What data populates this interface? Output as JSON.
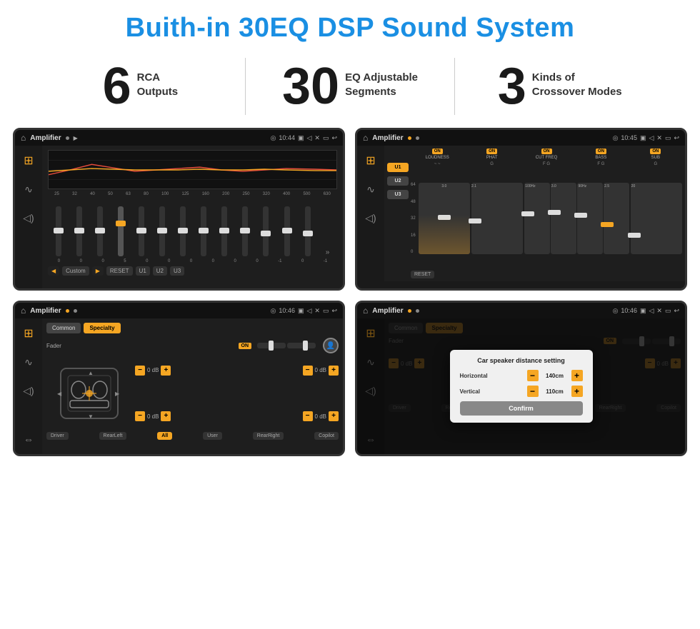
{
  "title": "Buith-in 30EQ DSP Sound System",
  "stats": [
    {
      "number": "6",
      "label": "RCA\nOutputs"
    },
    {
      "number": "30",
      "label": "EQ Adjustable\nSegments"
    },
    {
      "number": "3",
      "label": "Kinds of\nCrossover Modes"
    }
  ],
  "screens": [
    {
      "id": "eq-screen",
      "statusTime": "10:44",
      "title": "Amplifier",
      "freqLabels": [
        "25",
        "32",
        "40",
        "50",
        "63",
        "80",
        "100",
        "125",
        "160",
        "200",
        "250",
        "320",
        "400",
        "500",
        "630"
      ],
      "sliderValues": [
        "0",
        "0",
        "0",
        "5",
        "0",
        "0",
        "0",
        "0",
        "0",
        "0",
        "-1",
        "0",
        "-1"
      ],
      "bottomBtns": [
        "Custom",
        "RESET",
        "U1",
        "U2",
        "U3"
      ]
    },
    {
      "id": "crossover-screen",
      "statusTime": "10:45",
      "title": "Amplifier",
      "presets": [
        "U1",
        "U2",
        "U3"
      ],
      "channels": [
        "LOUDNESS",
        "PHAT",
        "CUT FREQ",
        "BASS",
        "SUB"
      ],
      "resetBtn": "RESET"
    },
    {
      "id": "fader-screen",
      "statusTime": "10:46",
      "title": "Amplifier",
      "tabs": [
        "Common",
        "Specialty"
      ],
      "faderLabel": "Fader",
      "dbValues": [
        "0 dB",
        "0 dB",
        "0 dB",
        "0 dB"
      ],
      "bottomLabels": [
        "Driver",
        "RearLeft",
        "All",
        "User",
        "RearRight",
        "Copilot"
      ]
    },
    {
      "id": "dialog-screen",
      "statusTime": "10:46",
      "title": "Amplifier",
      "tabs": [
        "Common",
        "Specialty"
      ],
      "dialogTitle": "Car speaker distance setting",
      "dialogFields": [
        {
          "label": "Horizontal",
          "value": "140cm"
        },
        {
          "label": "Vertical",
          "value": "110cm"
        }
      ],
      "confirmLabel": "Confirm",
      "dbValues": [
        "0 dB",
        "0 dB"
      ],
      "bottomLabels": [
        "Driver",
        "RearLeft",
        "All",
        "User",
        "RearRight",
        "Copilot"
      ]
    }
  ],
  "icons": {
    "home": "⌂",
    "settings": "≡",
    "wave": "∿",
    "speaker": "◁",
    "tune": "⊞",
    "back": "↩",
    "pin": "◎",
    "camera": "▣",
    "volume": "◁",
    "close": "✕",
    "window": "▭",
    "person": "👤"
  }
}
